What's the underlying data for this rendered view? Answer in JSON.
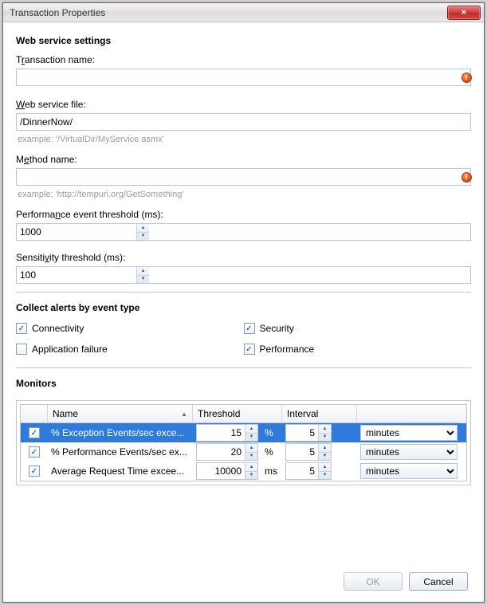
{
  "window": {
    "title": "Transaction Properties",
    "close_glyph": "×"
  },
  "sections": {
    "web_service": "Web service settings",
    "collect_alerts": "Collect alerts by event type",
    "monitors": "Monitors"
  },
  "labels": {
    "transaction_name_pre": "T",
    "transaction_name_ul": "r",
    "transaction_name_post": "ansaction name:",
    "web_service_file_ul": "W",
    "web_service_file_post": "eb service file:",
    "method_name_pre": "M",
    "method_name_ul": "e",
    "method_name_post": "thod name:",
    "perf_threshold_pre": "Performa",
    "perf_threshold_ul": "n",
    "perf_threshold_post": "ce event threshold (ms):",
    "sens_threshold_pre": "Sensiti",
    "sens_threshold_ul": "v",
    "sens_threshold_post": "ity threshold (ms):"
  },
  "fields": {
    "transaction_name": "",
    "web_service_file": "/DinnerNow/",
    "method_name": "",
    "perf_threshold": "1000",
    "sens_threshold": "100"
  },
  "hints": {
    "web_service_file": "example: '/VirtualDir/MyService.asmx'",
    "method_name": "example: 'http://tempuri.org/GetSomething'"
  },
  "error_glyph": "!",
  "alerts": {
    "connectivity_pre": "",
    "connectivity_ul": "C",
    "connectivity_post": "onnectivity",
    "connectivity_checked": true,
    "security_pre": "",
    "security_ul": "S",
    "security_post": "ecurity",
    "security_checked": true,
    "app_failure_pre": "Application fai",
    "app_failure_ul": "l",
    "app_failure_post": "ure",
    "app_failure_checked": false,
    "performance_pre": "",
    "performance_ul": "P",
    "performance_post": "erformance",
    "performance_checked": true
  },
  "monitors_table": {
    "headers": {
      "name": "Name",
      "threshold": "Threshold",
      "interval": "Interval"
    },
    "rows": [
      {
        "checked": true,
        "name": "% Exception Events/sec exce...",
        "threshold": "15",
        "unit": "%",
        "interval": "5",
        "interval_unit": "minutes",
        "selected": true
      },
      {
        "checked": true,
        "name": "% Performance Events/sec ex...",
        "threshold": "20",
        "unit": "%",
        "interval": "5",
        "interval_unit": "minutes",
        "selected": false
      },
      {
        "checked": true,
        "name": "Average Request Time excee...",
        "threshold": "10000",
        "unit": "ms",
        "interval": "5",
        "interval_unit": "minutes",
        "selected": false
      }
    ]
  },
  "buttons": {
    "ok_ul": "O",
    "ok_post": "K",
    "cancel": "Cancel"
  }
}
